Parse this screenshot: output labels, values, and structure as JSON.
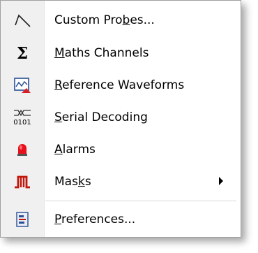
{
  "menu": {
    "items": [
      {
        "label_pre": "Custom Pro",
        "label_ul": "b",
        "label_post": "es...",
        "icon": "probe-icon"
      },
      {
        "label_pre": "",
        "label_ul": "M",
        "label_post": "aths Channels",
        "icon": "sigma-icon"
      },
      {
        "label_pre": "",
        "label_ul": "R",
        "label_post": "eference Waveforms",
        "icon": "reference-waveform-icon"
      },
      {
        "label_pre": "",
        "label_ul": "S",
        "label_post": "erial Decoding",
        "icon": "serial-decoding-icon",
        "icon_text": "0101"
      },
      {
        "label_pre": "",
        "label_ul": "A",
        "label_post": "larms",
        "icon": "alarm-icon"
      },
      {
        "label_pre": "Mas",
        "label_ul": "k",
        "label_post": "s",
        "icon": "mask-pulse-icon",
        "submenu": true
      },
      {
        "label_pre": "",
        "label_ul": "P",
        "label_post": "references...",
        "icon": "preferences-icon"
      }
    ]
  },
  "colors": {
    "alarm_red": "#e8101a",
    "mask_red": "#c2160a",
    "reference_red": "#d61f26",
    "icon_blue": "#2a4f94"
  }
}
